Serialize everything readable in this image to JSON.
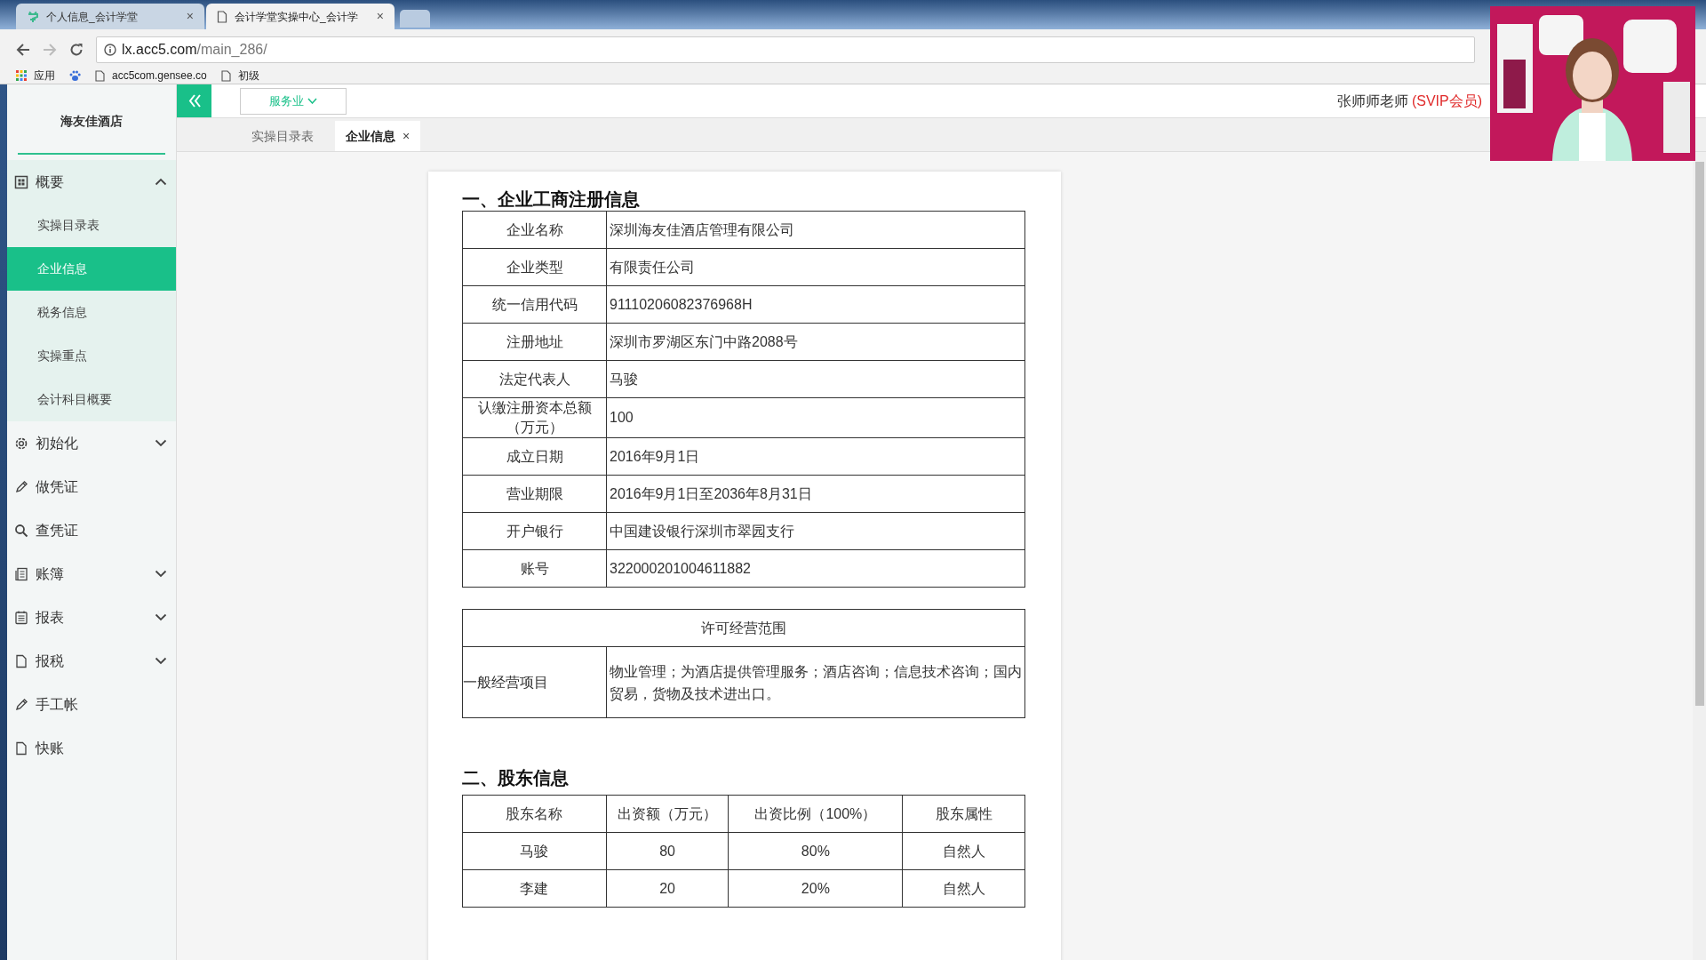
{
  "browser": {
    "tabs": [
      {
        "title": "个人信息_会计学堂",
        "selected": false,
        "close": "×"
      },
      {
        "title": "会计学堂实操中心_会计学",
        "selected": true,
        "close": "×"
      }
    ],
    "address": {
      "host": "lx.acc5.com",
      "path": "/main_286/"
    },
    "bookmarks": [
      {
        "label": "应用"
      },
      {
        "label": "acc5com.gensee.co"
      },
      {
        "label": "初级"
      }
    ]
  },
  "header": {
    "industry": "服务业",
    "user": "张师师老师",
    "membership": "(SVIP会员)"
  },
  "page_tabs": [
    {
      "label": "实操目录表",
      "selected": false
    },
    {
      "label": "企业信息",
      "selected": true,
      "close": "×"
    }
  ],
  "sidebar": {
    "company": "海友佳酒店",
    "menu": [
      {
        "label": "概要",
        "kind": "group",
        "expanded": true,
        "children": [
          {
            "label": "实操目录表",
            "selected": false
          },
          {
            "label": "企业信息",
            "selected": true
          },
          {
            "label": "税务信息",
            "selected": false
          },
          {
            "label": "实操重点",
            "selected": false
          },
          {
            "label": "会计科目概要",
            "selected": false
          }
        ]
      },
      {
        "label": "初始化",
        "kind": "group",
        "expanded": false
      },
      {
        "label": "做凭证",
        "kind": "link"
      },
      {
        "label": "查凭证",
        "kind": "link"
      },
      {
        "label": "账簿",
        "kind": "group",
        "expanded": false
      },
      {
        "label": "报表",
        "kind": "group",
        "expanded": false
      },
      {
        "label": "报税",
        "kind": "group",
        "expanded": false
      },
      {
        "label": "手工帐",
        "kind": "link"
      },
      {
        "label": "快账",
        "kind": "link"
      }
    ]
  },
  "registration": {
    "title": "一、企业工商注册信息",
    "rows": [
      {
        "label": "企业名称",
        "value": "深圳海友佳酒店管理有限公司"
      },
      {
        "label": "企业类型",
        "value": "有限责任公司"
      },
      {
        "label": "统一信用代码",
        "value": "91110206082376968H"
      },
      {
        "label": "注册地址",
        "value": "深圳市罗湖区东门中路2088号"
      },
      {
        "label": "法定代表人",
        "value": "马骏"
      },
      {
        "label": "认缴注册资本总额（万元）",
        "value": "100"
      },
      {
        "label": "成立日期",
        "value": "2016年9月1日"
      },
      {
        "label": "营业期限",
        "value": "2016年9月1日至2036年8月31日"
      },
      {
        "label": "开户银行",
        "value": "中国建设银行深圳市翠园支行"
      },
      {
        "label": "账号",
        "value": "322000201004611882"
      }
    ]
  },
  "scope": {
    "heading": "许可经营范围",
    "label": "一般经营项目",
    "value": "物业管理；为酒店提供管理服务；酒店咨询；信息技术咨询；国内贸易，货物及技术进出口。"
  },
  "shareholders": {
    "title": "二、股东信息",
    "columns": [
      "股东名称",
      "出资额（万元）",
      "出资比例（100%）",
      "股东属性"
    ],
    "rows": [
      [
        "马骏",
        "80",
        "80%",
        "自然人"
      ],
      [
        "李建",
        "20",
        "20%",
        "自然人"
      ]
    ]
  }
}
